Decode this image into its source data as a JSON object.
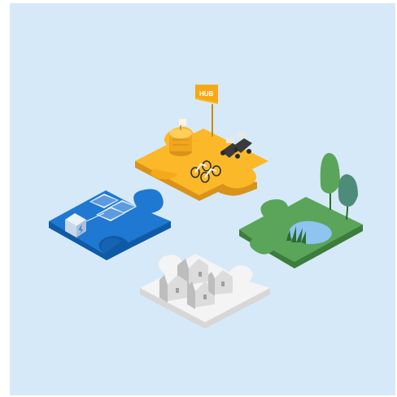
{
  "illustration": {
    "hub_flag_label": "HUB",
    "colors": {
      "background": "#d6e9f8",
      "mobility_piece": "#fbb829",
      "energy_piece": "#1f78d1",
      "nature_piece": "#5aa55a",
      "housing_piece": "#f4f4f4"
    },
    "pieces": [
      {
        "theme": "mobility-hub",
        "icons": [
          "hub-flag-icon",
          "cargo-cylinder-icon",
          "bicycle-icon",
          "scooter-icon"
        ]
      },
      {
        "theme": "solar-energy",
        "icons": [
          "solar-panel-icon",
          "battery-box-icon"
        ]
      },
      {
        "theme": "nature",
        "icons": [
          "tree-icon",
          "pond-icon",
          "reeds-icon"
        ]
      },
      {
        "theme": "housing",
        "icons": [
          "house-icon"
        ]
      }
    ]
  }
}
